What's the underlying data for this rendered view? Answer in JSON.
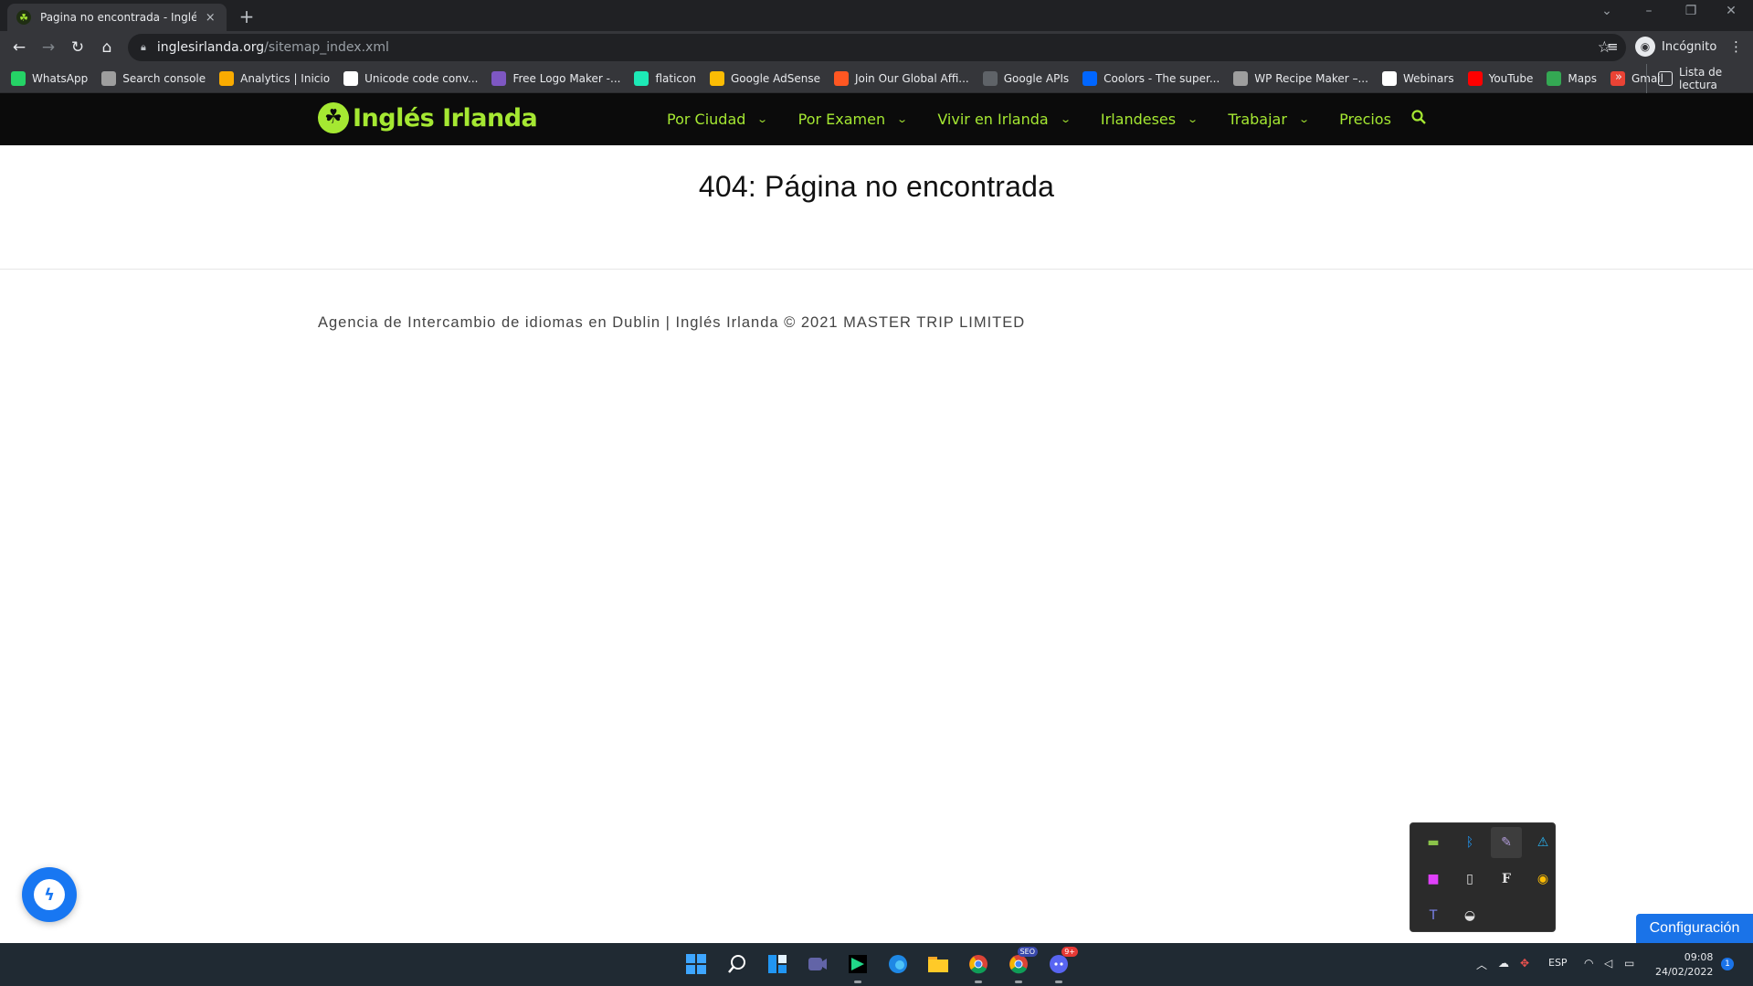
{
  "browser": {
    "tab_title": "Pagina no encontrada - Inglés Irlanda",
    "tab_close": "×",
    "new_tab": "+",
    "url_host": "inglesirlanda.org",
    "url_path": "/sitemap_index.xml",
    "profile_label": "Incógnito",
    "bookmarks": [
      {
        "label": "WhatsApp",
        "color": "#25d366"
      },
      {
        "label": "Search console",
        "color": "#9e9e9e"
      },
      {
        "label": "Analytics | Inicio",
        "color": "#f9ab00"
      },
      {
        "label": "Unicode code conv...",
        "color": "#ffffff"
      },
      {
        "label": "Free Logo Maker -...",
        "color": "#7e57c2"
      },
      {
        "label": "flaticon",
        "color": "#1de9b6"
      },
      {
        "label": "Google AdSense",
        "color": "#fbbc04"
      },
      {
        "label": "Join Our Global Affi...",
        "color": "#ff5722"
      },
      {
        "label": "Google APIs",
        "color": "#5f6368"
      },
      {
        "label": "Coolors - The super...",
        "color": "#0066ff"
      },
      {
        "label": "WP Recipe Maker –...",
        "color": "#9e9e9e"
      },
      {
        "label": "Webinars",
        "color": "#ffffff"
      },
      {
        "label": "YouTube",
        "color": "#ff0000"
      },
      {
        "label": "Maps",
        "color": "#34a853"
      },
      {
        "label": "Gmail",
        "color": "#ea4335"
      }
    ],
    "bookmarks_more": "»",
    "reading_list": "Lista de lectura"
  },
  "site": {
    "logo_text": "Inglés Irlanda",
    "nav": [
      {
        "label": "Por Ciudad",
        "has_dropdown": true
      },
      {
        "label": "Por Examen",
        "has_dropdown": true
      },
      {
        "label": "Vivir en Irlanda",
        "has_dropdown": true
      },
      {
        "label": "Irlandeses",
        "has_dropdown": true
      },
      {
        "label": "Trabajar",
        "has_dropdown": true
      },
      {
        "label": "Precios",
        "has_dropdown": false
      }
    ],
    "brand_color": "#a5e832",
    "page_title": "404: Página no encontrada",
    "footer_text": "Agencia de Intercambio de idiomas en Dublin | Inglés Irlanda © 2021 MASTER TRIP LIMITED",
    "config_button": "Configuración"
  },
  "taskbar": {
    "language": "ESP",
    "time": "09:08",
    "date": "24/02/2022",
    "notifications": "1",
    "apps": [
      "windows-start",
      "search",
      "widgets",
      "teams-chat",
      "pycharm",
      "edge",
      "file-explorer",
      "chrome",
      "chrome-seo",
      "discord"
    ],
    "discord_badge": "9+",
    "chrome_seo_badge": "SEO"
  },
  "tray_popup_icons": [
    "network-monitor",
    "bluetooth",
    "feather-app",
    "shield-warning",
    "color-app",
    "usb-drive",
    "font-app",
    "chrome-tray",
    "teams",
    "discord-tray"
  ]
}
